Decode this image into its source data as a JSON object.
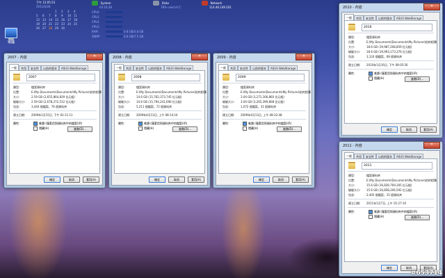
{
  "gadgets": {
    "clock": {
      "time": "下午 12:05:53",
      "date": "2011/6/28"
    },
    "calendar": {
      "rows": [
        [
          "",
          "",
          "",
          "1",
          "2",
          "3",
          "4"
        ],
        [
          "5",
          "6",
          "7",
          "8",
          "9",
          "10",
          "11"
        ],
        [
          "12",
          "13",
          "14",
          "15",
          "16",
          "17",
          "18"
        ],
        [
          "19",
          "20",
          "21",
          "22",
          "23",
          "24",
          "25"
        ],
        [
          "26",
          "27",
          "28",
          "29",
          "30",
          "",
          ""
        ]
      ],
      "today": "28"
    },
    "system": {
      "title": "System",
      "uptime": "03:16:28",
      "rows": [
        {
          "label": "CPU0",
          "value": ""
        },
        {
          "label": "CPU1",
          "value": ""
        },
        {
          "label": "CPU2",
          "value": ""
        },
        {
          "label": "CPU3",
          "value": ""
        },
        {
          "label": "RAM",
          "value": "0.8 GB/3.8 GB"
        },
        {
          "label": "SWAP",
          "value": "0.6 GB/7.5 GB"
        }
      ]
    },
    "disks": {
      "title": "Disks",
      "line": "78% used of C:",
      "fill": 0.78
    },
    "network": {
      "title": "Network",
      "ip": "114.46.149.201"
    }
  },
  "desktop_icon": {
    "label": "電腦"
  },
  "common": {
    "tabs": [
      "一般",
      "共用",
      "安全性",
      "以前的版本",
      "ASUS WebStorage"
    ],
    "labels": {
      "type": "類型:",
      "location": "位置:",
      "size": "大小:",
      "size_on_disk": "磁碟大小:",
      "contains": "包含:",
      "created": "建立日期:",
      "attributes": "屬性:"
    },
    "type_value": "檔案資料夾",
    "location_value": "E:\\My Documents\\Documents\\My Pictures\\拍的相簿",
    "readonly": "唯讀 (僅套用到資料夾中的檔案)(R)",
    "readonly_short": "唯讀 (僅套用到資料夾中的檔案)(R)",
    "hidden": "隱藏(H)",
    "advanced": "進階(D)...",
    "ok": "確定",
    "cancel": "取消",
    "apply": "套用(A)",
    "close": "✕"
  },
  "windows": [
    {
      "title": "2007 - 內容",
      "name": "2007",
      "size": "2.59 GB (2,655,864,839 位元組)",
      "size_on_disk": "2.59 GB (2,678,272,512 位元組)",
      "contains": "3,444 個檔案，76 個資料夾",
      "created": "2009年1月15日, 下午 02:11:11"
    },
    {
      "title": "2008 - 內容",
      "name": "2008",
      "size": "14.6 GB (15,762,373,745 位元組)",
      "size_on_disk": "14.6 GB (15,794,241,696 位元組)",
      "contains": "5,211 個檔案，72 個資料夾",
      "created": "2009年4月13日, 上午 08:14:16"
    },
    {
      "title": "2009 - 內容",
      "name": "2009",
      "size": "3.04 GB (3,271,166,860 位元組)",
      "size_on_disk": "3.04 GB (3,265,399,808 位元組)",
      "contains": "1,072 個檔案，31 個資料夾",
      "created": "2009年4月13日, 上午 08:22:48"
    },
    {
      "title": "2010 - 內容",
      "name": "2010",
      "size": "18.6 GB (19,987,208,859 位元組)",
      "size_on_disk": "18.6 GB (19,993,173,376 位元組)",
      "contains": "3,124 個檔案，68 個資料夾",
      "created": "2010年1月16日, 下午 08:05:56"
    },
    {
      "title": "2011 - 內容",
      "name": "2011",
      "size": "15.6 GB (16,839,769,305 位元組)",
      "size_on_disk": "15.6 GB (16,858,206,592 位元組)",
      "contains": "2,405 個檔案，15 個資料夾",
      "created": "2011年1月7日, 上午 01:27:10"
    }
  ],
  "watermark": "#653714"
}
